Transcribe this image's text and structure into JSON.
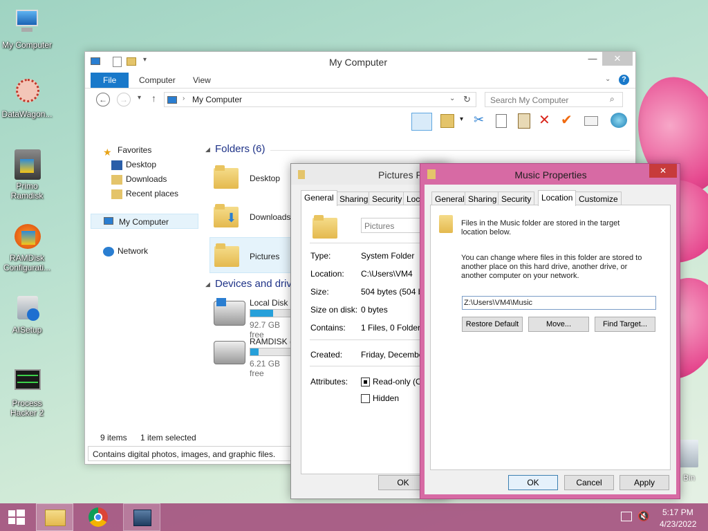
{
  "desktop": {
    "icons": [
      {
        "label": "My Computer"
      },
      {
        "label": "DataWagon..."
      },
      {
        "label": "Primo Ramdisk"
      },
      {
        "label": "RAMDisk Configurati..."
      },
      {
        "label": "AISetup"
      },
      {
        "label": "Process Hacker 2"
      }
    ],
    "recycle_bin_label": "Bin"
  },
  "explorer": {
    "title": "My Computer",
    "ribbon_tabs": [
      "File",
      "Computer",
      "View"
    ],
    "address": "My Computer",
    "search_placeholder": "Search My Computer",
    "nav": {
      "favorites": "Favorites",
      "desktop": "Desktop",
      "downloads": "Downloads",
      "recent": "Recent places",
      "computer": "My Computer",
      "network": "Network"
    },
    "folders_header": "Folders (6)",
    "folders": [
      "Desktop",
      "Downloads",
      "Pictures"
    ],
    "devices_header": "Devices and driv",
    "drives": [
      {
        "name": "Local Disk (",
        "free": "92.7 GB free",
        "fill": 0.55
      },
      {
        "name": "RAMDISK (",
        "free": "6.21 GB free",
        "fill": 0.2
      }
    ],
    "status_items": "9 items",
    "status_selected": "1 item selected",
    "info_tip": "Contains digital photos, images, and graphic files."
  },
  "pictures_dialog": {
    "title": "Pictures P",
    "tabs": [
      "General",
      "Sharing",
      "Security",
      "Loca"
    ],
    "name_value": "Pictures",
    "rows": [
      {
        "k": "Type:",
        "v": "System Folder"
      },
      {
        "k": "Location:",
        "v": "C:\\Users\\VM4"
      },
      {
        "k": "Size:",
        "v": "504 bytes (504 by"
      },
      {
        "k": "Size on disk:",
        "v": "0 bytes"
      },
      {
        "k": "Contains:",
        "v": "1 Files, 0 Folders"
      },
      {
        "k": "Created:",
        "v": "Friday, December"
      }
    ],
    "attributes_label": "Attributes:",
    "readonly_label": "Read-only (Onl",
    "hidden_label": "Hidden",
    "ok": "OK"
  },
  "music_dialog": {
    "title": "Music Properties",
    "close": "✕",
    "tabs": [
      "General",
      "Sharing",
      "Security",
      "Location",
      "Customize"
    ],
    "info1": "Files in the Music folder are stored in the target location below.",
    "info2": "You can change where files in this folder are stored to another place on this hard drive, another drive, or another computer on your network.",
    "path_value": "Z:\\Users\\VM4\\Music",
    "restore_default": "Restore Default",
    "move": "Move...",
    "find_target": "Find Target...",
    "ok": "OK",
    "cancel": "Cancel",
    "apply": "Apply"
  },
  "taskbar": {
    "time": "5:17 PM",
    "date": "4/23/2022"
  },
  "colors": {
    "accent": "#1979ca",
    "dialog_border": "#d76aa4",
    "taskbar": "#a04678"
  }
}
